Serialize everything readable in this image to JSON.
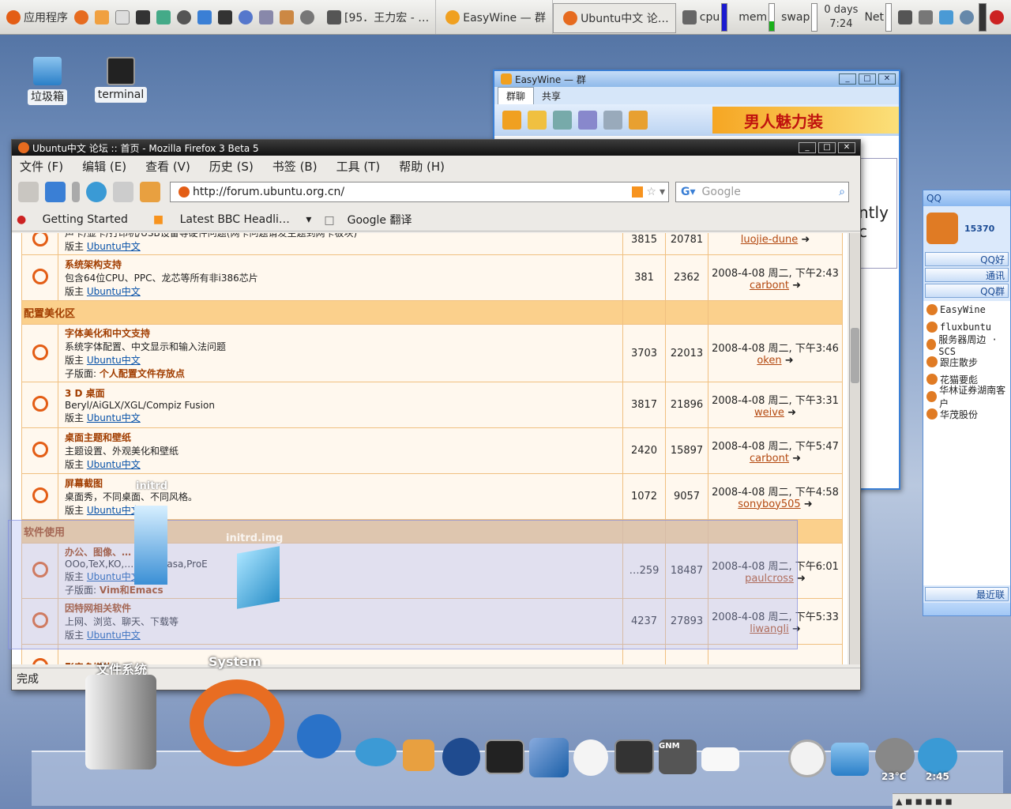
{
  "top_panel": {
    "apps_menu": "应用程序",
    "tasks": [
      {
        "label": "[95．王力宏 - …"
      },
      {
        "label": "EasyWine — 群"
      },
      {
        "label": "Ubuntu中文 论…"
      }
    ],
    "monitors": {
      "cpu": "cpu",
      "mem": "mem",
      "swap": "swap",
      "net": "Net"
    },
    "uptime_days": "0 days",
    "uptime_time": "7:24"
  },
  "desktop": {
    "trash_label": "垃圾箱",
    "terminal_label": "terminal"
  },
  "easywine": {
    "title": "EasyWine — 群",
    "tab_group_chat": "群聊",
    "tab_share": "共享",
    "ad_text": "男人魅力装",
    "partial_text": "ntly c"
  },
  "qq": {
    "title": "QQ",
    "number": "15370",
    "buttons": [
      "QQ好",
      "通讯",
      "QQ群"
    ],
    "contacts": [
      "EasyWine",
      "fluxbuntu",
      "服务器周边 · SCS",
      "跟庄散步",
      "花猫要彪",
      "华林证券湖南客户",
      "华茂股份"
    ],
    "recent": "最近联"
  },
  "firefox": {
    "title": "Ubuntu中文 论坛 :: 首页 - Mozilla Firefox 3 Beta 5",
    "menu": [
      "文件 (F)",
      "编辑 (E)",
      "查看 (V)",
      "历史 (S)",
      "书签 (B)",
      "工具 (T)",
      "帮助 (H)"
    ],
    "url": "http://forum.ubuntu.org.cn/",
    "search_placeholder": "Google",
    "bookmarks": [
      "Getting Started",
      "Latest BBC Headli…",
      "Google 翻译"
    ],
    "status": "完成"
  },
  "forum": {
    "rows": [
      {
        "type": "forum",
        "title": "",
        "desc": "声卡/显卡/打印机/USB设备等硬件问题(网卡问题请发主题到网卡板块)",
        "mod_label": "版主",
        "mod": "Ubuntu中文",
        "topics": "3815",
        "posts": "20781",
        "last_time": "",
        "last_user": "luojie-dune"
      },
      {
        "type": "forum",
        "title": "系统架构支持",
        "desc": "包含64位CPU、PPC、龙芯等所有非i386芯片",
        "mod_label": "版主",
        "mod": "Ubuntu中文",
        "topics": "381",
        "posts": "2362",
        "last_time": "2008-4-08 周二, 下午2:43",
        "last_user": "carbont"
      },
      {
        "type": "section",
        "title": "配置美化区"
      },
      {
        "type": "forum",
        "title": "字体美化和中文支持",
        "desc": "系统字体配置、中文显示和输入法问题",
        "mod_label": "版主",
        "mod": "Ubuntu中文",
        "sub_label": "子版面:",
        "sub": "个人配置文件存放点",
        "topics": "3703",
        "posts": "22013",
        "last_time": "2008-4-08 周二, 下午3:46",
        "last_user": "oken"
      },
      {
        "type": "forum",
        "title": "3 D 桌面",
        "desc": "Beryl/AiGLX/XGL/Compiz Fusion",
        "mod_label": "版主",
        "mod": "Ubuntu中文",
        "topics": "3817",
        "posts": "21896",
        "last_time": "2008-4-08 周二, 下午3:31",
        "last_user": "weive"
      },
      {
        "type": "forum",
        "title": "桌面主题和壁纸",
        "desc": "主题设置、外观美化和壁纸",
        "mod_label": "版主",
        "mod": "Ubuntu中文",
        "topics": "2420",
        "posts": "15897",
        "last_time": "2008-4-08 周二, 下午5:47",
        "last_user": "carbont"
      },
      {
        "type": "forum",
        "title": "屏幕截图",
        "desc": "桌面秀，不同桌面、不同风格。",
        "mod_label": "版主",
        "mod": "Ubuntu中文",
        "topics": "1072",
        "posts": "9057",
        "last_time": "2008-4-08 周二, 下午4:58",
        "last_user": "sonyboy505"
      },
      {
        "type": "section",
        "title": "软件使用"
      },
      {
        "type": "forum",
        "title": "办公、图像、… 设计等",
        "desc": "OOo,TeX,KO,… MP,Picasa,ProE",
        "mod_label": "版主",
        "mod": "Ubuntu中文",
        "sub_label": "子版面:",
        "sub": "Vim和Emacs",
        "topics": "…259",
        "posts": "18487",
        "last_time": "2008-4-08 周二, 下午6:01",
        "last_user": "paulcross"
      },
      {
        "type": "forum",
        "title": "因特网相关软件",
        "desc": "上网、浏览、聊天、下载等",
        "mod_label": "版主",
        "mod": "Ubuntu中文",
        "topics": "4237",
        "posts": "27893",
        "last_time": "2008-4-08 周二, 下午5:33",
        "last_user": "liwangli"
      },
      {
        "type": "forum",
        "title": "影音多媒体",
        "desc": "",
        "mod_label": "",
        "mod": "",
        "topics": "",
        "posts": "",
        "last_time": "",
        "last_user": ""
      }
    ]
  },
  "overlay": {
    "initrd": "initrd",
    "initrd_img": "initrd.img"
  },
  "dock": {
    "filesystem_label": "文件系统",
    "system_label": "System",
    "temperature": "23°C",
    "clock_time": "2:45",
    "gnm_label": "GNM"
  },
  "colors": {
    "forum_accent": "#a13d00",
    "section_bg": "#fbd08c",
    "ubuntu_orange": "#e35d15"
  }
}
